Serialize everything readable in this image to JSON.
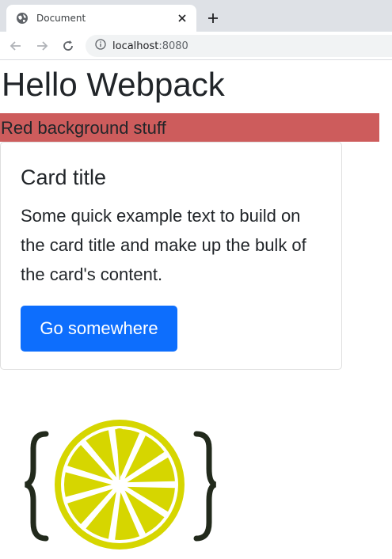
{
  "browser": {
    "tab": {
      "title": "Document",
      "icon": "globe-icon",
      "close_icon": "close-icon"
    },
    "new_tab_icon": "plus-icon",
    "toolbar": {
      "back_icon": "back-arrow-icon",
      "forward_icon": "forward-arrow-icon",
      "reload_icon": "reload-icon",
      "info_icon": "info-icon",
      "url_host": "localhost",
      "url_port": ":8080"
    }
  },
  "page": {
    "heading": "Hello Webpack",
    "red_section": {
      "text": "Red background stuff",
      "background": "#cd5c5c"
    },
    "card": {
      "title": "Card title",
      "text": "Some quick example text to build on the card title and make up the bulk of the card's content.",
      "button_label": "Go somewhere",
      "button_color": "#0d6efd"
    },
    "logo": {
      "icon": "lemon-braces-logo"
    }
  }
}
